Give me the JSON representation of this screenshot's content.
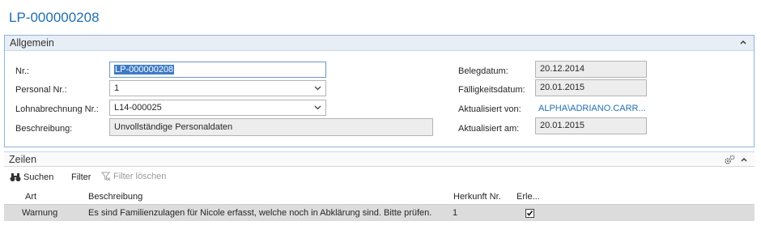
{
  "page": {
    "title": "LP-000000208"
  },
  "general": {
    "section_title": "Allgemein",
    "fields": {
      "nr": {
        "label": "Nr.:",
        "value": "LP-000000208"
      },
      "personal_nr": {
        "label": "Personal Nr.:",
        "value": "1"
      },
      "lohnabrechnung_nr": {
        "label": "Lohnabrechnung Nr.:",
        "value": "L14-000025"
      },
      "beschreibung": {
        "label": "Beschreibung:",
        "value": "Unvollständige Personaldaten"
      },
      "belegdatum": {
        "label": "Belegdatum:",
        "value": "20.12.2014"
      },
      "faelligkeitsdatum": {
        "label": "Fälligkeitsdatum:",
        "value": "20.01.2015"
      },
      "aktualisiert_von": {
        "label": "Aktualisiert von:",
        "value": "ALPHA\\ADRIANO.CARR..."
      },
      "aktualisiert_am": {
        "label": "Aktualisiert am:",
        "value": "20.01.2015"
      }
    }
  },
  "lines": {
    "section_title": "Zeilen",
    "toolbar": {
      "search": "Suchen",
      "filter": "Filter",
      "clear_filter": "Filter löschen"
    },
    "columns": {
      "art": "Art",
      "beschreibung": "Beschreibung",
      "herkunft": "Herkunft Nr.",
      "erledigt": "Erle..."
    },
    "rows": [
      {
        "art": "Warnung",
        "beschreibung": "Es sind Familienzulagen für Nicole erfasst, welche noch in Abklärung sind. Bitte prüfen.",
        "herkunft": "1",
        "erledigt": true
      }
    ]
  },
  "colors": {
    "accent": "#1f6fb5",
    "selection": "#3d7ac6",
    "row_highlight": "#dcdcdc"
  }
}
